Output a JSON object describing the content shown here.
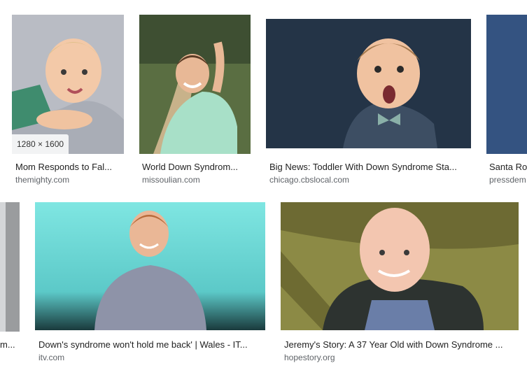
{
  "results": [
    {
      "title": "Mom Responds to Fal...",
      "source": "themighty.com",
      "dims": "1280 × 1600"
    },
    {
      "title": "World Down Syndrom...",
      "source": "missoulian.com"
    },
    {
      "title": "Big News: Toddler With Down Syndrome Sta...",
      "source": "chicago.cbslocal.com"
    },
    {
      "title": "Santa Ro",
      "source": "pressdem"
    },
    {
      "title": "m...",
      "source": ""
    },
    {
      "title": "Down's syndrome won't hold me back' | Wales - IT...",
      "source": "itv.com"
    },
    {
      "title": "Jeremy's Story: A 37 Year Old with Down Syndrome ...",
      "source": "hopestory.org"
    }
  ]
}
